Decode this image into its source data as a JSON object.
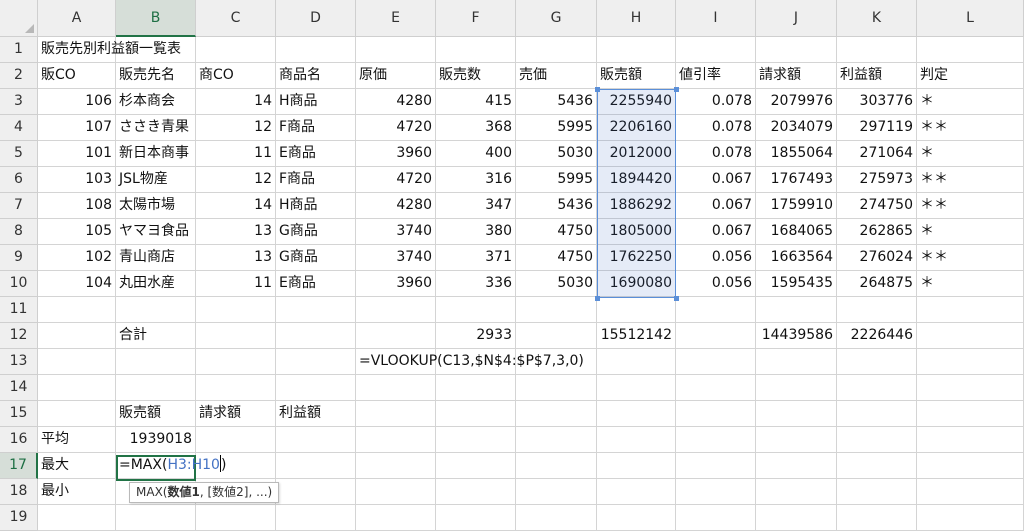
{
  "columns": [
    "A",
    "B",
    "C",
    "D",
    "E",
    "F",
    "G",
    "H",
    "I",
    "J",
    "K",
    "L"
  ],
  "rows": [
    "1",
    "2",
    "3",
    "4",
    "5",
    "6",
    "7",
    "8",
    "9",
    "10",
    "11",
    "12",
    "13",
    "14",
    "15",
    "16",
    "17",
    "18",
    "19"
  ],
  "title": "販売先別利益額一覧表",
  "headers": [
    "販CO",
    "販売先名",
    "商CO",
    "商品名",
    "原価",
    "販売数",
    "売価",
    "販売額",
    "値引率",
    "請求額",
    "利益額",
    "判定"
  ],
  "data_rows": [
    [
      "106",
      "杉本商会",
      "14",
      "H商品",
      "4280",
      "415",
      "5436",
      "2255940",
      "0.078",
      "2079976",
      "303776",
      "＊"
    ],
    [
      "107",
      "ささき青果",
      "12",
      "F商品",
      "4720",
      "368",
      "5995",
      "2206160",
      "0.078",
      "2034079",
      "297119",
      "＊＊"
    ],
    [
      "101",
      "新日本商事",
      "11",
      "E商品",
      "3960",
      "400",
      "5030",
      "2012000",
      "0.078",
      "1855064",
      "271064",
      "＊"
    ],
    [
      "103",
      "JSL物産",
      "12",
      "F商品",
      "4720",
      "316",
      "5995",
      "1894420",
      "0.067",
      "1767493",
      "275973",
      "＊＊"
    ],
    [
      "108",
      "太陽市場",
      "14",
      "H商品",
      "4280",
      "347",
      "5436",
      "1886292",
      "0.067",
      "1759910",
      "274750",
      "＊＊"
    ],
    [
      "105",
      "ヤマヨ食品",
      "13",
      "G商品",
      "3740",
      "380",
      "4750",
      "1805000",
      "0.067",
      "1684065",
      "262865",
      "＊"
    ],
    [
      "102",
      "青山商店",
      "13",
      "G商品",
      "3740",
      "371",
      "4750",
      "1762250",
      "0.056",
      "1663564",
      "276024",
      "＊＊"
    ],
    [
      "104",
      "丸田水産",
      "11",
      "E商品",
      "3960",
      "336",
      "5030",
      "1690080",
      "0.056",
      "1595435",
      "264875",
      "＊"
    ]
  ],
  "total_label": "合計",
  "totals": {
    "F": "2933",
    "H": "15512142",
    "J": "14439586",
    "K": "2226446"
  },
  "note_formula": "=VLOOKUP(C13,$N$4:$P$7,3,0)",
  "summary_headers": [
    "販売額",
    "請求額",
    "利益額"
  ],
  "summary_labels": {
    "avg": "平均",
    "max": "最大",
    "min": "最小"
  },
  "avg_value": "1939018",
  "edit": {
    "prefix": "=MAX(",
    "ref": "H3:H10",
    "suffix": ")"
  },
  "tooltip": {
    "func": "MAX(",
    "arg1": "数値1",
    "rest": ", [数値2], ...)"
  }
}
